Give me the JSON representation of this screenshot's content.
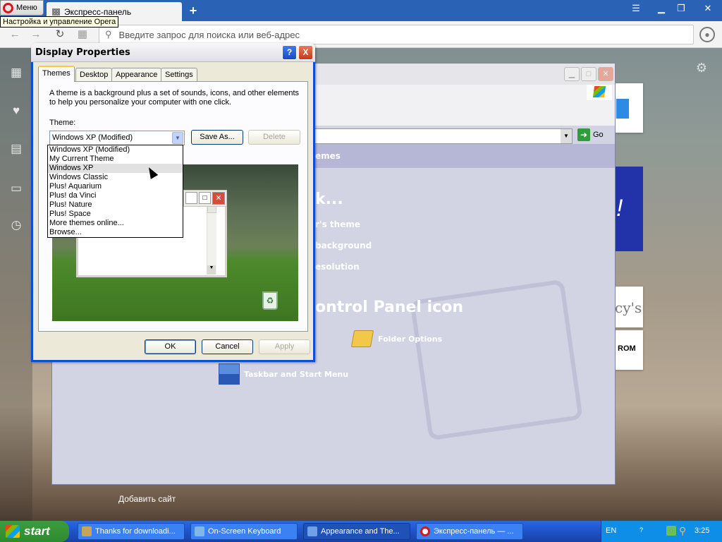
{
  "browser": {
    "menu_label": "Меню",
    "menu_tooltip": "Настройка и управление Opera",
    "tab_title": "Экспресс-панель",
    "new_tab": "+",
    "address_placeholder": "Введите запрос для поиска или веб-адрес",
    "add_site": "Добавить сайт"
  },
  "control_panel": {
    "go_label": "Go",
    "band_text": "emes",
    "heading": "k...",
    "links": [
      "r's theme",
      "background",
      "esolution"
    ],
    "section_title": "ontrol Panel icon",
    "icons": [
      {
        "label": "Folder Options",
        "icon": "folder-options-icon"
      },
      {
        "label": "Taskbar and Start Menu",
        "icon": "taskbar-icon"
      }
    ],
    "tile_texts": [
      "cy's",
      "ROM"
    ],
    "tile_exclaim": "!"
  },
  "dialog": {
    "title": "Display Properties",
    "help": "?",
    "close": "X",
    "tabs": [
      "Themes",
      "Desktop",
      "Appearance",
      "Settings"
    ],
    "active_tab": "Themes",
    "description": "A theme is a background plus a set of sounds, icons, and other elements to help you personalize your computer with one click.",
    "theme_label": "Theme:",
    "theme_value": "Windows XP (Modified)",
    "save_as": "Save As...",
    "delete": "Delete",
    "options": [
      "Windows XP (Modified)",
      "My Current Theme",
      "Windows XP",
      "Windows Classic",
      "Plus! Aquarium",
      "Plus! da Vinci",
      "Plus! Nature",
      "Plus! Space",
      "More themes online...",
      "Browse..."
    ],
    "highlighted_option": "Windows XP",
    "ok": "OK",
    "cancel": "Cancel",
    "apply": "Apply"
  },
  "taskbar": {
    "start": "start",
    "tasks": [
      {
        "label": "Thanks for downloadi...",
        "color": "#c9a35a"
      },
      {
        "label": "On-Screen Keyboard",
        "color": "#7fb7e8"
      },
      {
        "label": "Appearance and The...",
        "color": "#6fa0e8"
      },
      {
        "label": "Экспресс-панель — ...",
        "color": "#d7161c"
      }
    ],
    "lang": "EN",
    "clock": "3:25"
  }
}
